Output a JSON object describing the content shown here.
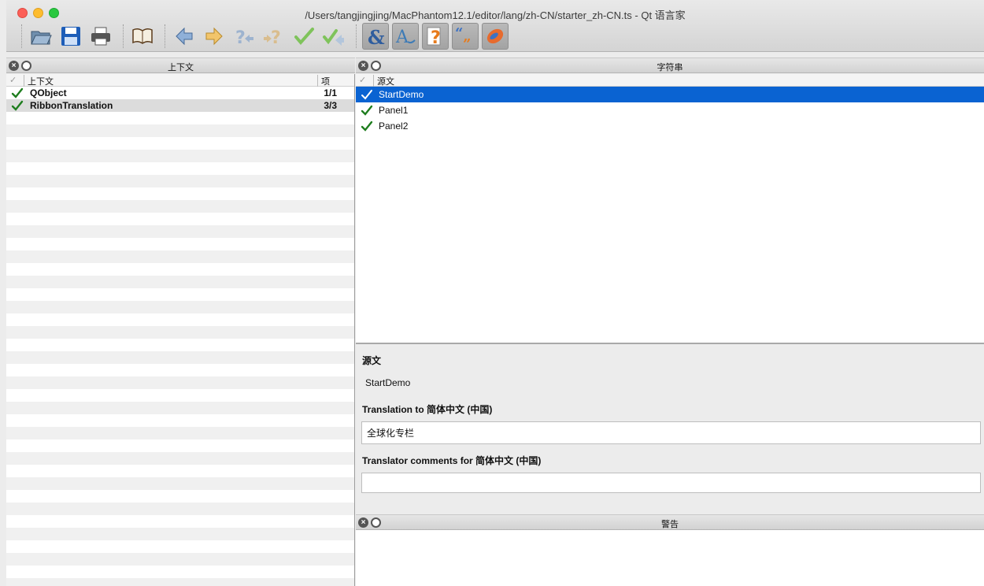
{
  "window": {
    "title": "/Users/tangjingjing/MacPhantom12.1/editor/lang/zh-CN/starter_zh-CN.ts - Qt 语言家"
  },
  "toolbar": {
    "buttons": [
      {
        "name": "open-icon"
      },
      {
        "name": "save-icon"
      },
      {
        "name": "print-icon"
      },
      {
        "name": "phrasebook-icon"
      },
      {
        "name": "prev-icon"
      },
      {
        "name": "next-icon"
      },
      {
        "name": "prev-unfinished-icon"
      },
      {
        "name": "next-unfinished-icon"
      },
      {
        "name": "done-icon"
      },
      {
        "name": "done-next-icon"
      },
      {
        "name": "accelerators-icon"
      },
      {
        "name": "ending-punctuation-icon"
      },
      {
        "name": "phrase-matches-icon"
      },
      {
        "name": "quotes-icon"
      },
      {
        "name": "place-markers-icon"
      }
    ]
  },
  "context_pane": {
    "title": "上下文",
    "col_context": "上下文",
    "col_items": "项",
    "rows": [
      {
        "name": "QObject",
        "count": "1/1"
      },
      {
        "name": "RibbonTranslation",
        "count": "3/3"
      }
    ]
  },
  "strings_pane": {
    "title": "字符串",
    "col_source": "源文",
    "rows": [
      {
        "name": "StartDemo"
      },
      {
        "name": "Panel1"
      },
      {
        "name": "Panel2"
      }
    ]
  },
  "editor": {
    "source_label": "源文",
    "source_text": "StartDemo",
    "translation_label": "Translation to 简体中文 (中国)",
    "translation_value": "全球化专栏",
    "comments_label": "Translator comments for 简体中文 (中国)",
    "comments_value": ""
  },
  "warnings_pane": {
    "title": "警告"
  },
  "colors": {
    "selection": "#0a63d2",
    "check_green": "#1e7d1e"
  }
}
